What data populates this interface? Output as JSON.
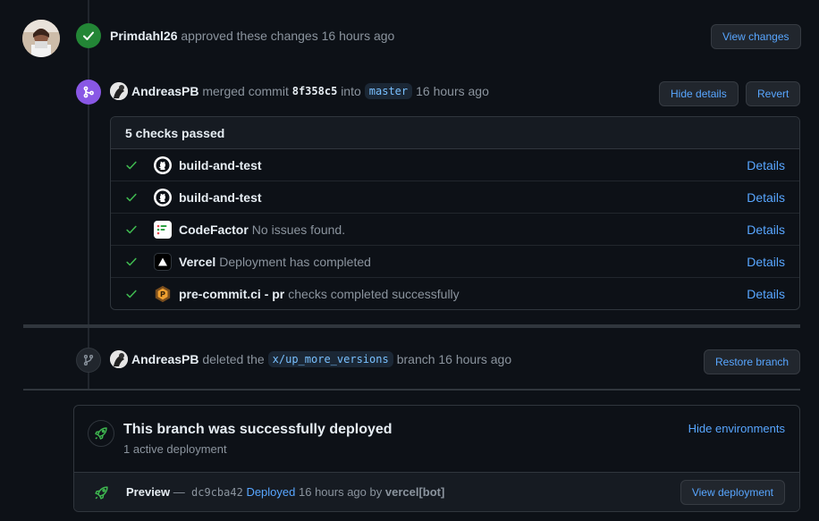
{
  "review": {
    "user": "Primdahl26",
    "action": "approved these changes",
    "time": "16 hours ago",
    "view_changes_label": "View changes"
  },
  "merge": {
    "user": "AndreasPB",
    "action": "merged commit",
    "commit": "8f358c5",
    "into": "into",
    "branch": "master",
    "time": "16 hours ago",
    "hide_details_label": "Hide details",
    "revert_label": "Revert"
  },
  "checks": {
    "header": "5 checks passed",
    "rows": [
      {
        "name": "build-and-test",
        "desc": "",
        "details": "Details",
        "icon": "github-icon"
      },
      {
        "name": "build-and-test",
        "desc": "",
        "details": "Details",
        "icon": "github-icon"
      },
      {
        "name": "CodeFactor",
        "desc": "No issues found.",
        "details": "Details",
        "icon": "codefactor-icon"
      },
      {
        "name": "Vercel",
        "desc": "Deployment has completed",
        "details": "Details",
        "icon": "vercel-icon"
      },
      {
        "name": "pre-commit.ci - pr",
        "desc": "checks completed successfully",
        "details": "Details",
        "icon": "precommit-icon"
      }
    ]
  },
  "delete": {
    "user": "AndreasPB",
    "action": "deleted the",
    "branch": "x/up_more_versions",
    "suffix": "branch 16 hours ago",
    "restore_label": "Restore branch"
  },
  "deploy": {
    "title": "This branch was successfully deployed",
    "subtitle": "1 active deployment",
    "hide_env_label": "Hide environments",
    "env": "Preview",
    "dash": "—",
    "commit": "dc9cba42",
    "status": "Deployed",
    "time": "16 hours ago by",
    "bot": "vercel[bot]",
    "view_label": "View deployment"
  },
  "colors": {
    "success": "#238636",
    "merged": "#8957e5",
    "link": "#58a6ff"
  }
}
